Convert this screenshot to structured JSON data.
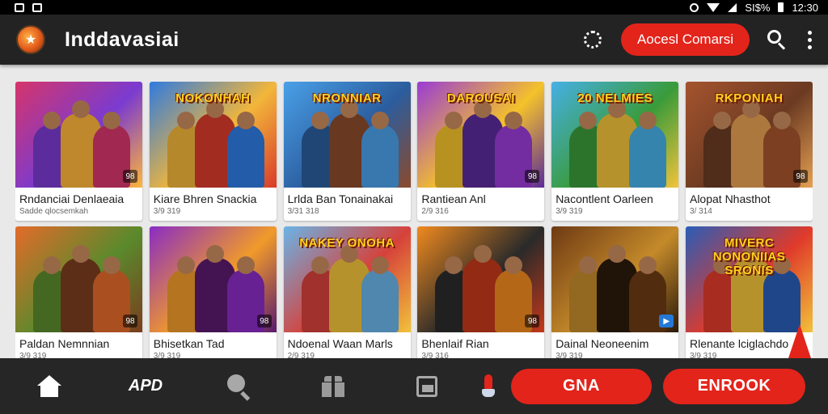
{
  "status_bar": {
    "left_icons": [
      "square-icon",
      "square-icon"
    ],
    "battery_label": "SI$%",
    "time": "12:30"
  },
  "app_bar": {
    "title": "Inddavasiai",
    "cta_label": "Aocesl Comarsi",
    "logo_icon": "game-logo-icon",
    "action_icon": "refresh-icon",
    "search_icon": "search-icon",
    "more_icon": "more-vert-icon"
  },
  "cards": [
    {
      "banner": "",
      "title": "Rndanciai Denlaeaia",
      "subtitle": "Sadde qlocsemkah",
      "badge": "98",
      "badge_style": "dark",
      "colors": [
        "#d6356a",
        "#7a3bd0",
        "#ffb53a"
      ]
    },
    {
      "banner": "NOKONHAH",
      "title": "Kiare Bhren Snackia",
      "subtitle": "3/9 319",
      "badge": "",
      "badge_style": "none",
      "colors": [
        "#2f7be0",
        "#f2b63a",
        "#d83b2a"
      ]
    },
    {
      "banner": "NRONNIAR",
      "title": "Lrlda Ban Tonainakai",
      "subtitle": "3/31 318",
      "badge": "",
      "badge_style": "none",
      "colors": [
        "#4aa0e8",
        "#2b5d9e",
        "#8a4a2c"
      ]
    },
    {
      "banner": "DAROUSAI",
      "title": "Rantiean Anl",
      "subtitle": "2/9 316",
      "badge": "98",
      "badge_style": "dark",
      "colors": [
        "#9a3bd6",
        "#f4c22a",
        "#5b2a9a"
      ]
    },
    {
      "banner": "20 NELMIES",
      "title": "Nacontlent Oarleen",
      "subtitle": "3/9 319",
      "badge": "",
      "badge_style": "none",
      "colors": [
        "#46b0e6",
        "#3a9b3a",
        "#f2c33a"
      ]
    },
    {
      "banner": "RKPONIAH",
      "title": "Alopat Nhasthot",
      "subtitle": "3/ 314",
      "badge": "98",
      "badge_style": "dark",
      "colors": [
        "#a5542e",
        "#6b3a22",
        "#e5a052"
      ]
    },
    {
      "banner": "",
      "title": "Paldan Nemnnian",
      "subtitle": "3/9 319",
      "badge": "98",
      "badge_style": "dark",
      "colors": [
        "#e36b2a",
        "#5a8a2c",
        "#7a3d1f"
      ]
    },
    {
      "banner": "",
      "title": "Bhisetkan Tad",
      "subtitle": "3/9 319",
      "badge": "98",
      "badge_style": "dark",
      "colors": [
        "#8a2cc4",
        "#f09a2a",
        "#5a1a6e"
      ]
    },
    {
      "banner": "NAKEY ONOHA",
      "title": "Ndoenal Waan Marls",
      "subtitle": "2/9 319",
      "badge": "",
      "badge_style": "none",
      "colors": [
        "#6ab4e8",
        "#d6413a",
        "#f2c23a"
      ]
    },
    {
      "banner": "",
      "title": "Bhenlaif Rian",
      "subtitle": "3/9 316",
      "badge": "98",
      "badge_style": "dark",
      "colors": [
        "#f08a1e",
        "#2a2a2a",
        "#c4381a"
      ]
    },
    {
      "banner": "",
      "title": "Dainal Neoneenim",
      "subtitle": "3/9 319",
      "badge": "▶",
      "badge_style": "blue",
      "colors": [
        "#6e3a14",
        "#c48a2a",
        "#2a1a0a"
      ]
    },
    {
      "banner": "MIVERC NONONIIAS SRONIS",
      "title": "Rlenante lciglachdo",
      "subtitle": "3/9 319",
      "badge": "",
      "badge_style": "none",
      "colors": [
        "#2a5db8",
        "#e03a2a",
        "#f2c23a"
      ]
    }
  ],
  "bottom_nav": {
    "home_icon": "home-icon",
    "app_label": "APD",
    "search_icon": "search-icon",
    "gift_icon": "gift-icon",
    "library_icon": "library-icon",
    "profile_icon": "profile-icon",
    "primary_button": "GNA",
    "secondary_button": "ENROOK"
  },
  "colors": {
    "accent": "#e3241b",
    "app_bar": "#232323",
    "background": "#e9e9e9",
    "bottom_nav": "#262626"
  }
}
